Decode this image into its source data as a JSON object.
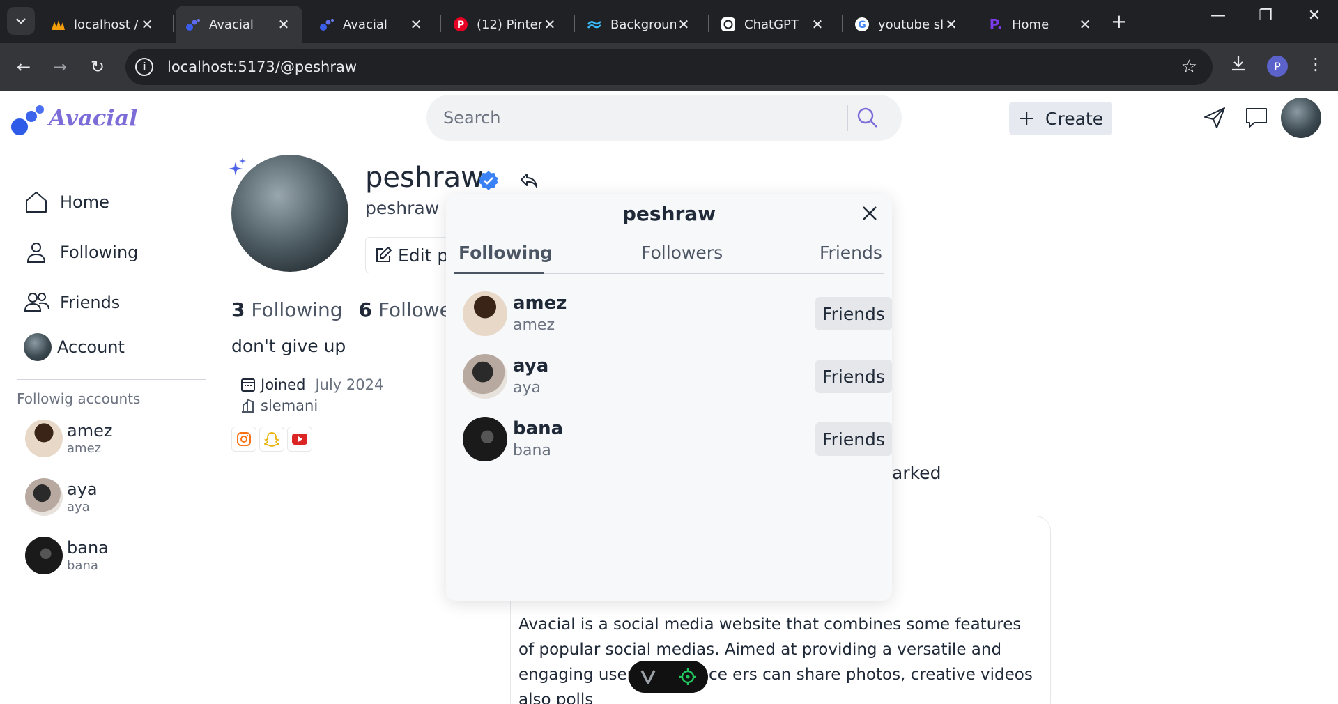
{
  "browser": {
    "tabs": [
      {
        "label": "localhost /",
        "favicon": "phpmyadmin-icon"
      },
      {
        "label": "Avacial",
        "favicon": "avacial-icon",
        "active": true
      },
      {
        "label": "Avacial",
        "favicon": "avacial-icon"
      },
      {
        "label": "(12) Pinter",
        "favicon": "pinterest-icon"
      },
      {
        "label": "Backgroun",
        "favicon": "tailwind-icon"
      },
      {
        "label": "ChatGPT",
        "favicon": "chatgpt-icon"
      },
      {
        "label": "youtube sl",
        "favicon": "google-icon"
      },
      {
        "label": "Home",
        "favicon": "p-icon"
      }
    ],
    "url": "localhost:5173/@peshraw",
    "profile_initial": "P"
  },
  "app": {
    "brand": "Avacial",
    "search_placeholder": "Search",
    "create_label": "Create"
  },
  "sidebar": {
    "nav": [
      {
        "label": "Home",
        "icon": "home-icon"
      },
      {
        "label": "Following",
        "icon": "user-icon"
      },
      {
        "label": "Friends",
        "icon": "users-icon"
      },
      {
        "label": "Account",
        "icon": "avatar"
      }
    ],
    "following_title": "Followig accounts",
    "accounts": [
      {
        "name": "amez",
        "username": "amez"
      },
      {
        "name": "aya",
        "username": "aya"
      },
      {
        "name": "bana",
        "username": "bana"
      }
    ]
  },
  "profile": {
    "display_name": "peshraw",
    "username": "peshraw",
    "edit_label": "Edit pr",
    "following_count": "3",
    "following_label": "Following",
    "followers_count": "6",
    "followers_label": "Followers",
    "bio": "don't give up",
    "joined_label": "Joined",
    "joined_value": "July 2024",
    "location": "slemani",
    "tab_partial": "arked",
    "post_text": "Avacial is a social media website that combines some features of popular social medias. Aimed at providing a versatile and engaging user experience ers can share photos, creative videos also polls"
  },
  "modal": {
    "title": "peshraw",
    "tabs": [
      "Following",
      "Followers",
      "Friends"
    ],
    "active_tab": "Following",
    "users": [
      {
        "name": "amez",
        "username": "amez",
        "button": "Friends"
      },
      {
        "name": "aya",
        "username": "aya",
        "button": "Friends"
      },
      {
        "name": "bana",
        "username": "bana",
        "button": "Friends"
      }
    ]
  },
  "colors": {
    "brand": "#7c6cd8",
    "logo_blue": "#2e5be8",
    "verified": "#3b82f6",
    "instagram": "#f97316",
    "snapchat": "#eab308",
    "youtube": "#dc2626"
  }
}
